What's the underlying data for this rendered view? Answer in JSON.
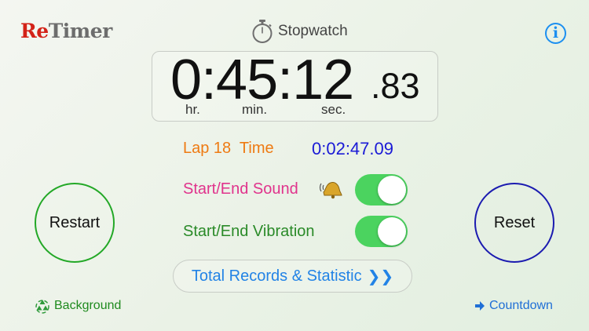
{
  "logo": {
    "part1": "Re",
    "part2": "Timer"
  },
  "header": {
    "mode_label": "Stopwatch",
    "mode_icon": "stopwatch-icon",
    "info_label": "i"
  },
  "timer": {
    "main": "0:45:12",
    "fraction": ".83",
    "units": {
      "hr": "hr.",
      "min": "min.",
      "sec": "sec."
    }
  },
  "lap": {
    "label": "Lap 18  Time",
    "value": "0:02:47.09"
  },
  "settings": {
    "sound": {
      "label": "Start/End Sound",
      "icon": "bell-icon",
      "enabled": true
    },
    "vibration": {
      "label": "Start/End Vibration",
      "enabled": true
    }
  },
  "records": {
    "label": "Total Records & Statistic",
    "chevron": "❯❯"
  },
  "buttons": {
    "restart": "Restart",
    "reset": "Reset"
  },
  "bottom": {
    "background_label": "Background",
    "background_icon": "recycle-icon",
    "countdown_label": "Countdown",
    "countdown_icon": "arrow-right-icon"
  },
  "colors": {
    "logo_red": "#d32218",
    "lap_label": "#ee7a12",
    "lap_value": "#1a1ad6",
    "sound_label": "#e0338c",
    "vibration_label": "#2a8a28",
    "toggle_on": "#4bd35f",
    "link_blue": "#2283e6",
    "restart_ring": "#23a827",
    "reset_ring": "#1b1bb0"
  }
}
